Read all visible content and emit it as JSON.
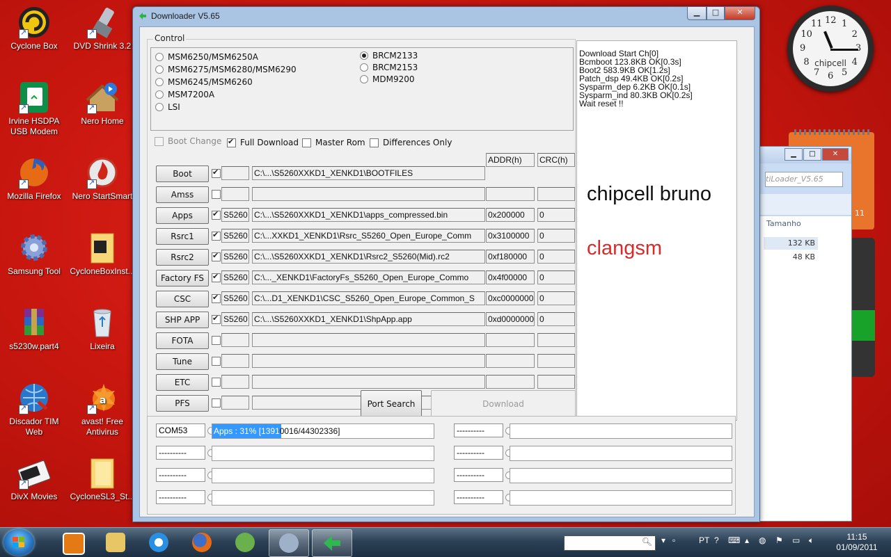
{
  "desktop_icons": [
    {
      "label": "Cyclone Box",
      "icon": "cyclone-icon"
    },
    {
      "label": "DVD Shrink 3.2",
      "icon": "dvd-shrink-icon"
    },
    {
      "label": "Irvine HSDPA USB Modem",
      "icon": "modem-icon"
    },
    {
      "label": "Nero Home",
      "icon": "nero-home-icon"
    },
    {
      "label": "Mozilla Firefox",
      "icon": "firefox-icon"
    },
    {
      "label": "Nero StartSmart",
      "icon": "nero-startsmart-icon"
    },
    {
      "label": "Samsung Tool",
      "icon": "gear-icon"
    },
    {
      "label": "CycloneBoxInst...",
      "icon": "folder-icon"
    },
    {
      "label": "s5230w.part4",
      "icon": "rar-archive-icon"
    },
    {
      "label": "Lixeira",
      "icon": "recycle-bin-icon"
    },
    {
      "label": "Discador TIM Web",
      "icon": "dialer-icon"
    },
    {
      "label": "avast! Free Antivirus",
      "icon": "avast-icon"
    },
    {
      "label": "DivX Movies",
      "icon": "divx-icon"
    },
    {
      "label": "CycloneSL3_St...",
      "icon": "folder-icon"
    }
  ],
  "clock_gadget": {
    "brand": "chipcell",
    "numbers": [
      "12",
      "1",
      "2",
      "3",
      "4",
      "5",
      "6",
      "7",
      "8",
      "9",
      "10",
      "11"
    ],
    "hour": 11,
    "minute": 15
  },
  "calendar_gadget": {
    "number": "11"
  },
  "explorer": {
    "search": "tiLoader_V5.65",
    "column": "Tamanho",
    "sizes": [
      "132 KB",
      "48 KB"
    ]
  },
  "window": {
    "title": "Downloader V5.65",
    "controls": {
      "minimize": "▁",
      "maximize": "□",
      "close": "✕"
    },
    "control_label": "Control",
    "chips_left": [
      {
        "label": "MSM6250/MSM6250A",
        "selected": false
      },
      {
        "label": "MSM6275/MSM6280/MSM6290",
        "selected": false
      },
      {
        "label": "MSM6245/MSM6260",
        "selected": false
      },
      {
        "label": "MSM7200A",
        "selected": false
      },
      {
        "label": "LSI",
        "selected": false
      }
    ],
    "chips_right": [
      {
        "label": "BRCM2133",
        "selected": true
      },
      {
        "label": "BRCM2153",
        "selected": false
      },
      {
        "label": "MDM9200",
        "selected": false
      }
    ],
    "options": {
      "boot_change": "Boot Change",
      "full_download": "Full Download",
      "master_rom": "Master Rom",
      "differences_only": "Differences Only"
    },
    "header": {
      "addr": "ADDR(h)",
      "crc": "CRC(h)"
    },
    "rows": [
      {
        "button": "Boot",
        "checked": true,
        "model": "",
        "path": "C:\\...\\S5260XXKD1_XENKD1\\BOOTFILES",
        "addr": "",
        "crc": ""
      },
      {
        "button": "Amss",
        "checked": false,
        "model": "",
        "path": "",
        "addr": "",
        "crc": ""
      },
      {
        "button": "Apps",
        "checked": true,
        "model": "S5260",
        "path": "C:\\...\\S5260XXKD1_XENKD1\\apps_compressed.bin",
        "addr": "0x200000",
        "crc": "0"
      },
      {
        "button": "Rsrc1",
        "checked": true,
        "model": "S5260",
        "path": "C:\\...XXKD1_XENKD1\\Rsrc_S5260_Open_Europe_Comm",
        "addr": "0x3100000",
        "crc": "0"
      },
      {
        "button": "Rsrc2",
        "checked": true,
        "model": "S5260",
        "path": "C:\\...\\S5260XXKD1_XENKD1\\Rsrc2_S5260(Mid).rc2",
        "addr": "0xf180000",
        "crc": "0"
      },
      {
        "button": "Factory FS",
        "checked": true,
        "model": "S5260",
        "path": "C:\\..._XENKD1\\FactoryFs_S5260_Open_Europe_Commo",
        "addr": "0x4f00000",
        "crc": "0"
      },
      {
        "button": "CSC",
        "checked": true,
        "model": "S5260",
        "path": "C:\\...D1_XENKD1\\CSC_S5260_Open_Europe_Common_S",
        "addr": "0xc0000000",
        "crc": "0"
      },
      {
        "button": "SHP APP",
        "checked": true,
        "model": "S5260",
        "path": "C:\\...\\S5260XXKD1_XENKD1\\ShpApp.app",
        "addr": "0xd0000000",
        "crc": "0"
      },
      {
        "button": "FOTA",
        "checked": false,
        "model": "",
        "path": "",
        "addr": "",
        "crc": ""
      },
      {
        "button": "Tune",
        "checked": false,
        "model": "",
        "path": "",
        "addr": "",
        "crc": ""
      },
      {
        "button": "ETC",
        "checked": false,
        "model": "",
        "path": "",
        "addr": "",
        "crc": ""
      },
      {
        "button": "PFS",
        "checked": false,
        "model": "",
        "path": "",
        "addr": "",
        "crc": ""
      }
    ],
    "port_search": "Port Search",
    "download": "Download",
    "log": [
      "Download Start Ch[0]",
      "Bcmboot 123.8KB OK[0.3s]",
      "Boot2 583.9KB OK[1.2s]",
      "Patch_dsp 49.4KB OK[0.2s]",
      "Sysparm_dep 6.2KB OK[0.1s]",
      "Sysparm_ind 80.3KB OK[0.2s]",
      "Wait reset !!"
    ],
    "watermark1": "chipcell bruno",
    "watermark2": "clangsm",
    "ports": [
      {
        "label": "COM53",
        "text_hl": "Apps : 31% [1391",
        "text_rest": "0016/44302336]",
        "progress": 0.31
      },
      {
        "label": "----------",
        "text_hl": "",
        "text_rest": "",
        "progress": 0
      },
      {
        "label": "----------",
        "text_hl": "",
        "text_rest": "",
        "progress": 0
      },
      {
        "label": "----------",
        "text_hl": "",
        "text_rest": "",
        "progress": 0
      },
      {
        "label": "----------",
        "text_hl": "",
        "text_rest": "",
        "progress": 0
      },
      {
        "label": "----------",
        "text_hl": "",
        "text_rest": "",
        "progress": 0
      },
      {
        "label": "----------",
        "text_hl": "",
        "text_rest": "",
        "progress": 0
      },
      {
        "label": "----------",
        "text_hl": "",
        "text_rest": "",
        "progress": 0
      }
    ]
  },
  "taskbar": {
    "apps": [
      "media-player-icon",
      "explorer-icon",
      "internet-explorer-icon",
      "firefox-icon",
      "people-icon",
      "gear-icon",
      "downloader-icon"
    ],
    "language": "PT",
    "time": "11:15",
    "date": "01/09/2011"
  },
  "colors": {
    "desktop": "#c9170f",
    "progress": "#3399ff",
    "watermark2": "#d62b2b"
  }
}
